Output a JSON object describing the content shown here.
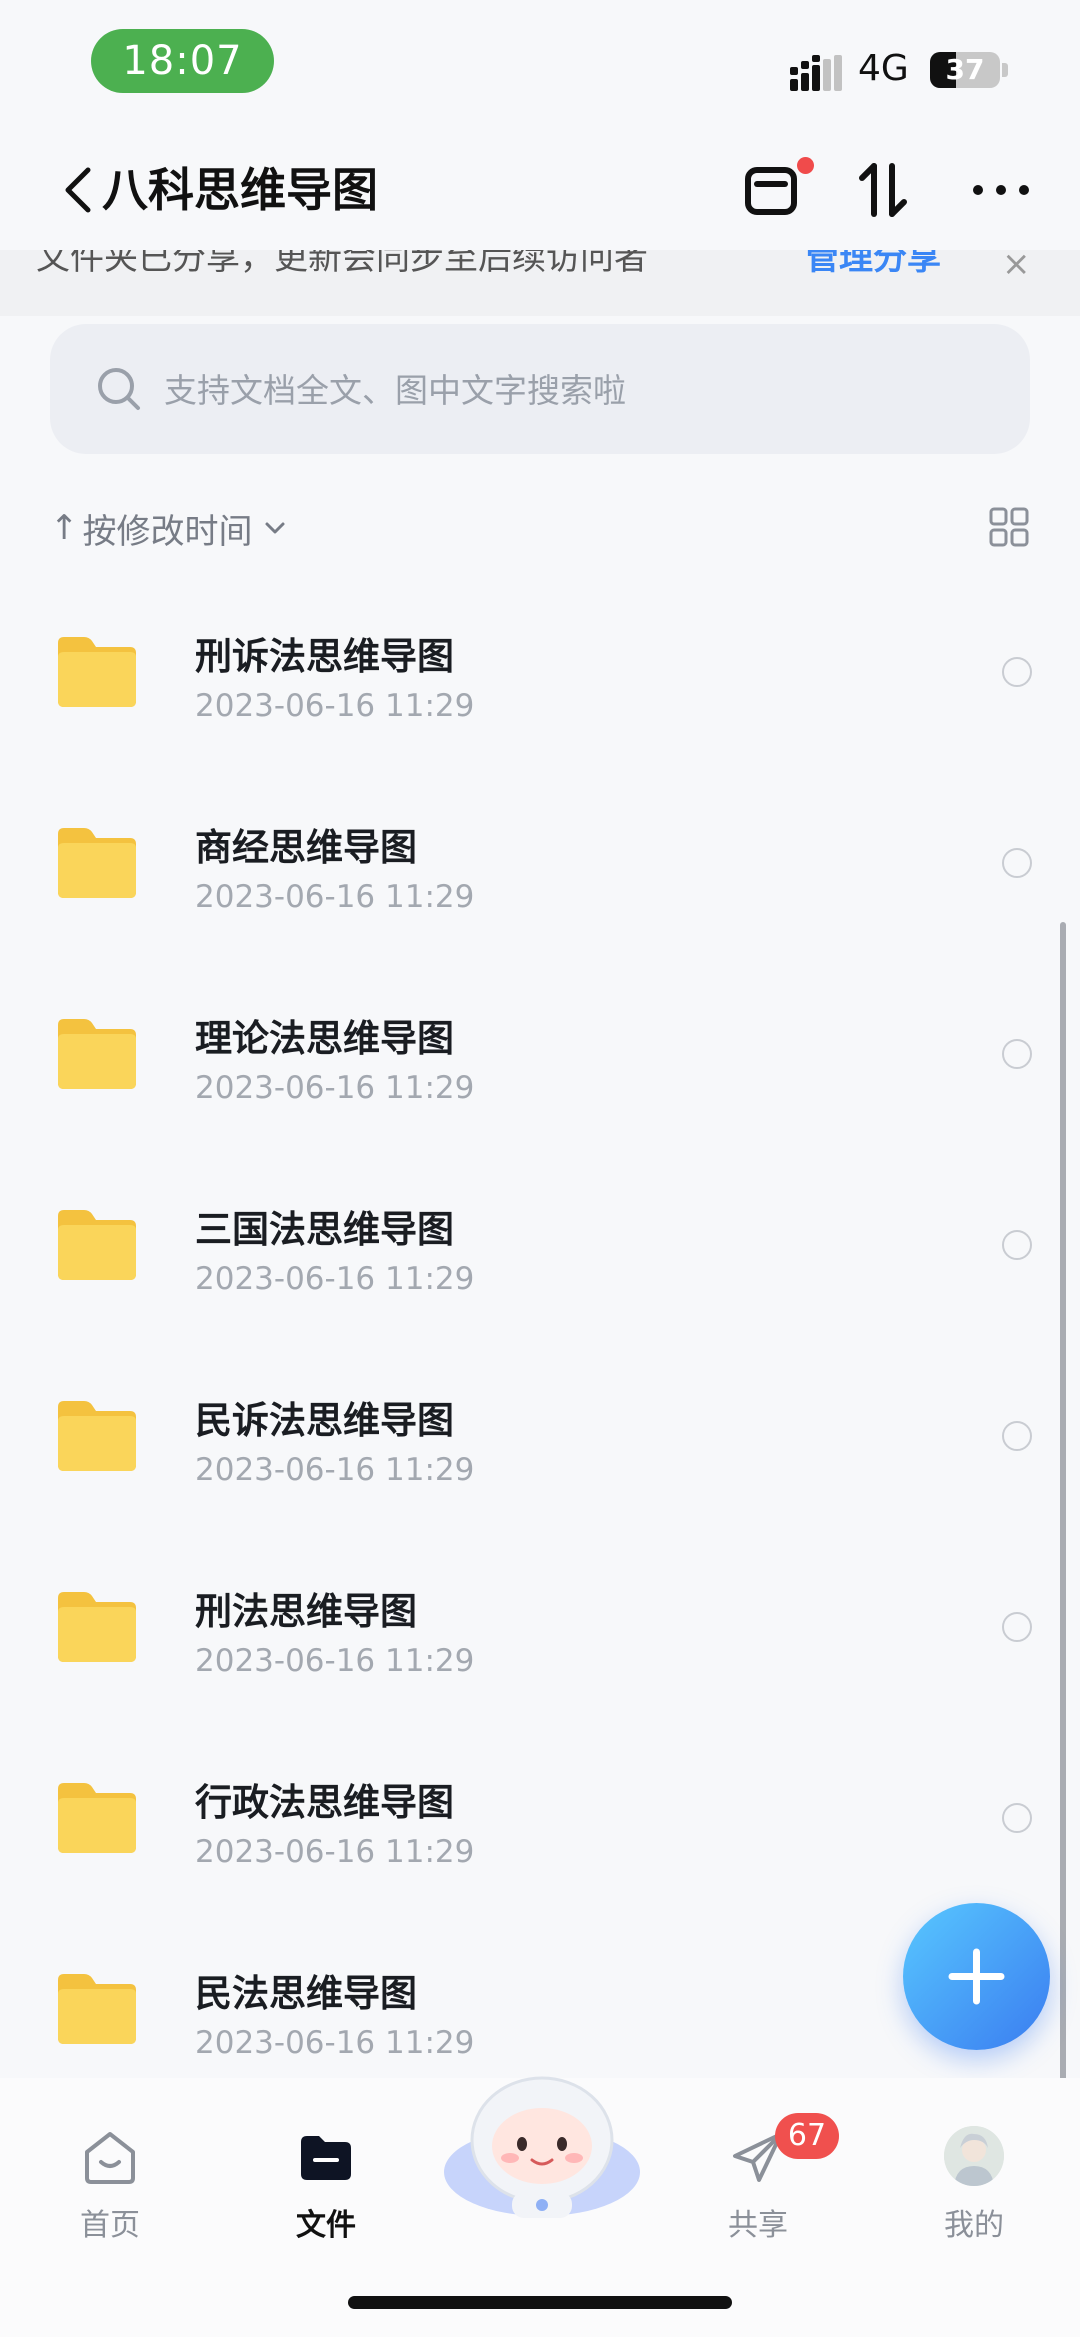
{
  "status_bar": {
    "time": "18:07",
    "network": "4G",
    "battery": "37",
    "battery_level": 0.37
  },
  "header": {
    "title": "八科思维导图",
    "back_icon": "chevron-left-icon",
    "transfer_icon": "transfer-list-icon",
    "sort_icon": "sort-arrows-icon",
    "more_icon": "more-dots-icon"
  },
  "banner": {
    "text": "文件夹已分享，更新会同步至后续访问者",
    "link_label": "管理分享",
    "close_label": "×"
  },
  "search": {
    "placeholder": "支持文档全文、图中文字搜索啦"
  },
  "sort": {
    "arrow": "↑",
    "label": "按修改时间"
  },
  "files": [
    {
      "name": "刑诉法思维导图",
      "date": "2023-06-16 11:29"
    },
    {
      "name": "商经思维导图",
      "date": "2023-06-16 11:29"
    },
    {
      "name": "理论法思维导图",
      "date": "2023-06-16 11:29"
    },
    {
      "name": "三国法思维导图",
      "date": "2023-06-16 11:29"
    },
    {
      "name": "民诉法思维导图",
      "date": "2023-06-16 11:29"
    },
    {
      "name": "刑法思维导图",
      "date": "2023-06-16 11:29"
    },
    {
      "name": "行政法思维导图",
      "date": "2023-06-16 11:29"
    },
    {
      "name": "民法思维导图",
      "date": "2023-06-16 11:29"
    }
  ],
  "nav": {
    "home": "首页",
    "files": "文件",
    "share": "共享",
    "mine": "我的",
    "share_badge": "67"
  },
  "colors": {
    "accent": "#3a86f5",
    "folder": "#f9cf4a",
    "badge": "#f0504e",
    "time_pill": "#4cb050"
  }
}
